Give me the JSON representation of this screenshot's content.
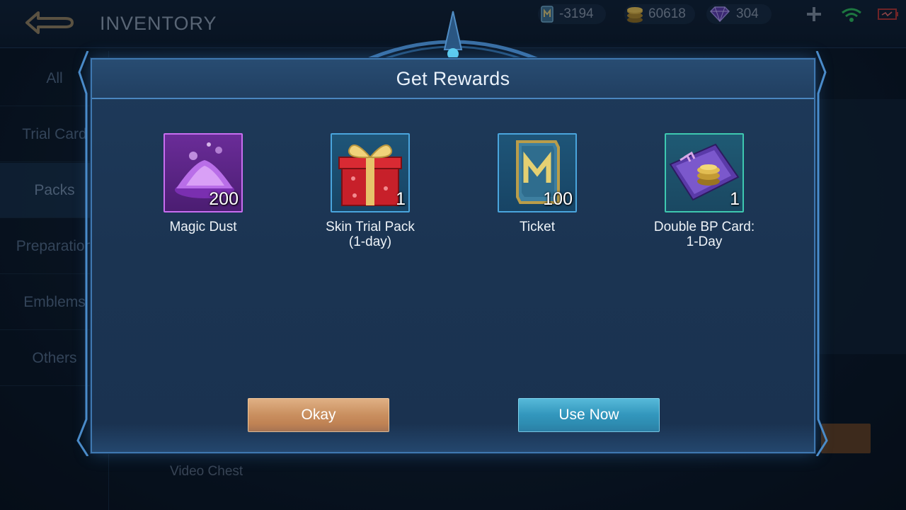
{
  "topbar": {
    "title": "INVENTORY",
    "currencies": [
      {
        "icon": "ticket-icon",
        "value": "-3194"
      },
      {
        "icon": "gold-coin-icon",
        "value": "60618"
      },
      {
        "icon": "diamond-icon",
        "value": "304"
      }
    ]
  },
  "sidebar": {
    "items": [
      {
        "label": "All"
      },
      {
        "label": "Trial Card"
      },
      {
        "label": "Packs",
        "active": true
      },
      {
        "label": "Preparation"
      },
      {
        "label": "Emblems"
      },
      {
        "label": "Others"
      }
    ]
  },
  "background": {
    "video_chest_label": "Video Chest"
  },
  "modal": {
    "title": "Get Rewards",
    "rewards": [
      {
        "name": "Magic Dust",
        "qty": "200",
        "icon": "magic-dust-icon",
        "rarity_color": "#c86ef0"
      },
      {
        "name_line1": "Skin Trial Pack",
        "name_line2": "(1-day)",
        "qty": "1",
        "icon": "gift-box-icon",
        "rarity_color": "#4aa5dd"
      },
      {
        "name": "Ticket",
        "qty": "100",
        "icon": "ticket-icon",
        "rarity_color": "#4aa5dd"
      },
      {
        "name_line1": "Double BP Card:",
        "name_line2": "1-Day",
        "qty": "1",
        "icon": "double-bp-card-icon",
        "rarity_color": "#3ec8b0"
      }
    ],
    "buttons": {
      "okay": "Okay",
      "use_now": "Use Now"
    }
  },
  "colors": {
    "okay_button": "#c98f5f",
    "use_now_button": "#3296bc",
    "frame_border": "#3f78b0"
  }
}
